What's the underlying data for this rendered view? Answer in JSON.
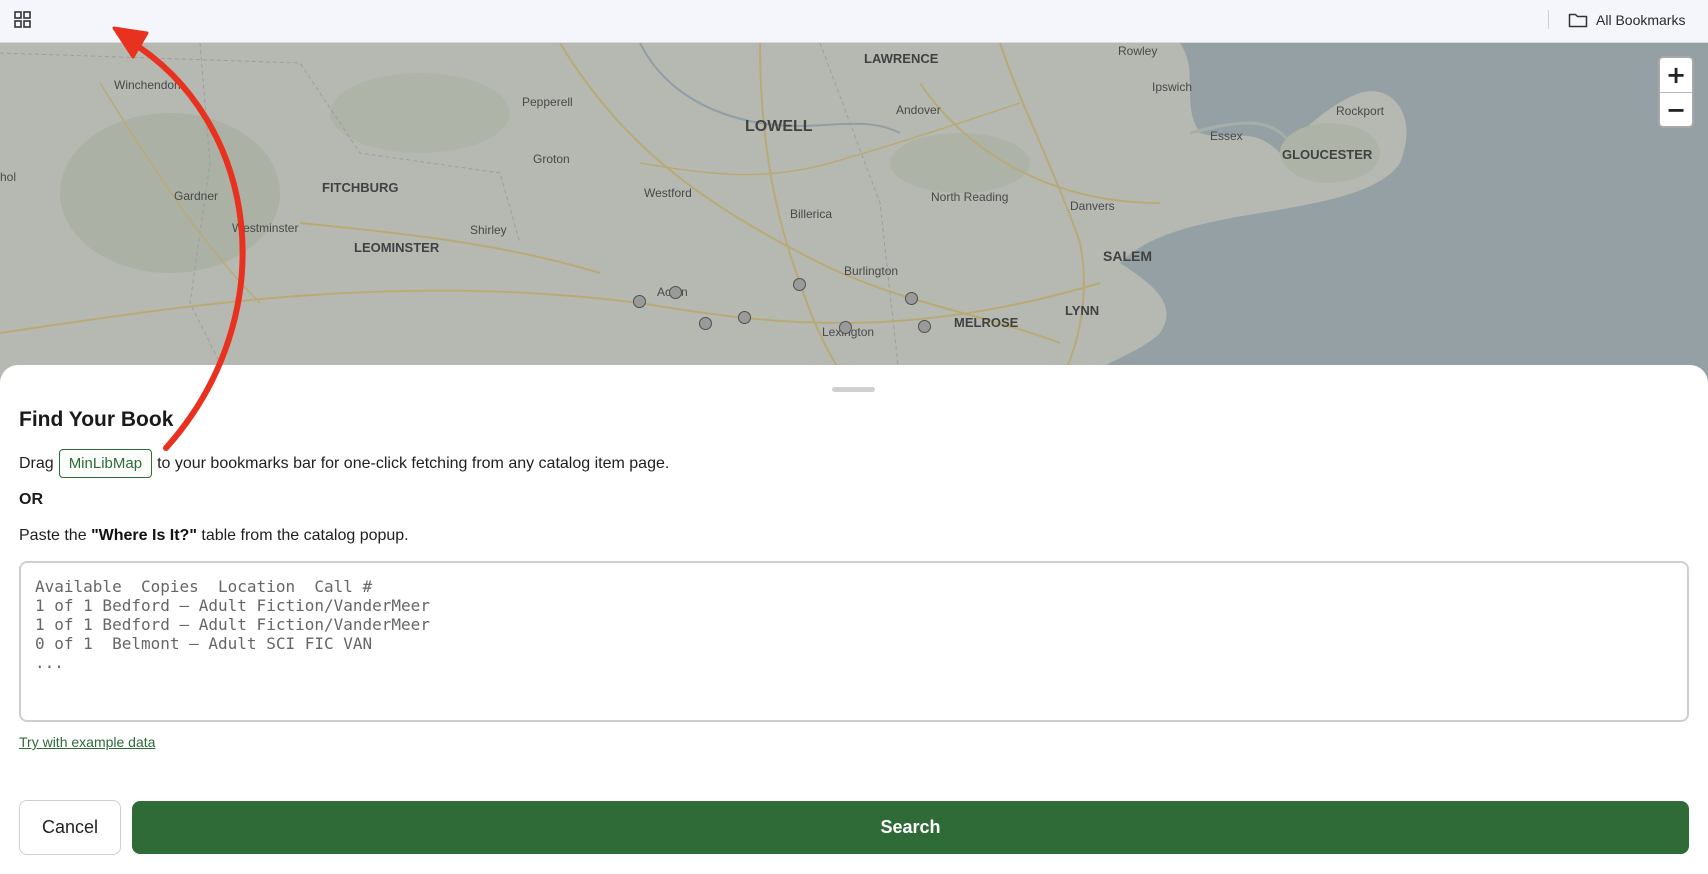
{
  "bookmarks_bar": {
    "all_bookmarks_label": "All Bookmarks"
  },
  "map": {
    "labels": {
      "winchendon": "Winchendon",
      "pepperell": "Pepperell",
      "lawrence": "LAWRENCE",
      "rowley": "Rowley",
      "ipswich": "Ipswich",
      "rockport": "Rockport",
      "lowell": "LOWELL",
      "andover": "Andover",
      "essex": "Essex",
      "gloucester": "GLOUCESTER",
      "hol": "hol",
      "gardner": "Gardner",
      "fitchburg": "FITCHBURG",
      "groton": "Groton",
      "westford": "Westford",
      "north_reading": "North Reading",
      "danvers": "Danvers",
      "westminster": "Westminster",
      "leominster": "LEOMINSTER",
      "shirley": "Shirley",
      "billerica": "Billerica",
      "salem": "SALEM",
      "burlington": "Burlington",
      "acton": "Acton",
      "lynn": "LYNN",
      "melrose": "MELROSE",
      "lexington": "Lexington"
    },
    "zoom_in_label": "+",
    "zoom_out_label": "−"
  },
  "sheet": {
    "title": "Find Your Book",
    "drag_prefix": "Drag",
    "bookmarklet_label": "MinLibMap",
    "drag_suffix": "to your bookmarks bar for one-click fetching from any catalog item page.",
    "or_label": "OR",
    "paste_prefix": "Paste the",
    "paste_bold": "\"Where Is It?\"",
    "paste_suffix": "table from the catalog popup.",
    "textarea_placeholder": "Available  Copies  Location  Call #\n1 of 1 Bedford – Adult Fiction/VanderMeer\n1 of 1 Bedford – Adult Fiction/VanderMeer\n0 of 1  Belmont – Adult SCI FIC VAN\n...",
    "example_link": "Try with example data",
    "cancel_label": "Cancel",
    "search_label": "Search"
  },
  "colors": {
    "accent_green": "#2e6b37",
    "arrow_red": "#e8321f"
  }
}
